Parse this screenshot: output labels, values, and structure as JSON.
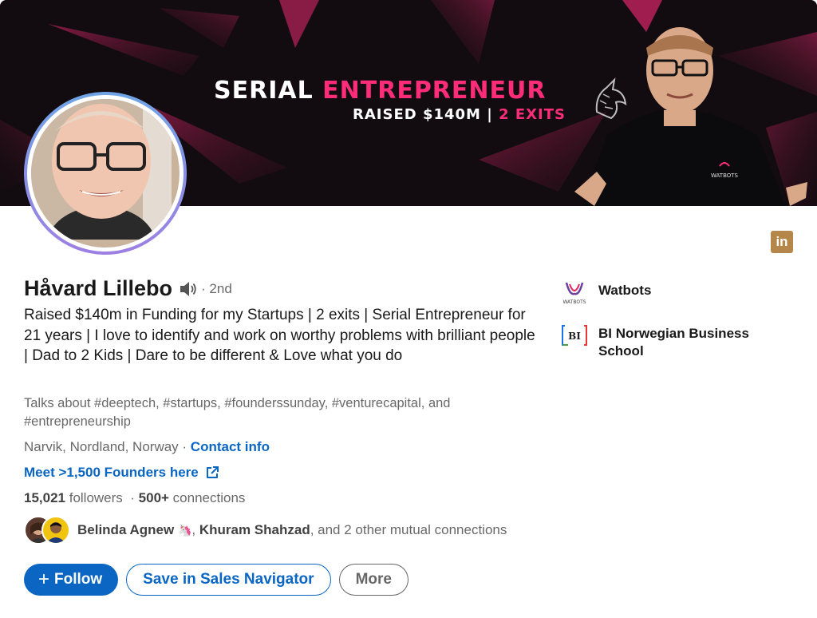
{
  "banner": {
    "title_white": "SERIAL",
    "title_accent": "ENTREPRENEUR",
    "subtitle_white": "RAISED $140M |",
    "subtitle_accent": "2 EXITS",
    "shirt_logo_text": "WATBOTS"
  },
  "profile": {
    "name": "Håvard Lillebo",
    "degree": "· 2nd",
    "headline": "Raised $140m in Funding for my Startups | 2 exits | Serial Entrepreneur for 21 years | I love to identify and work on worthy problems with brilliant people | Dad to 2 Kids | Dare to be different & Love what you do",
    "talks_about": "Talks about #deeptech, #startups, #founderssunday, #venturecapital, and #entrepreneurship",
    "location": "Narvik, Nordland, Norway",
    "location_sep": " · ",
    "contact_info": "Contact info",
    "website_link": "Meet >1,500 Founders here",
    "followers_count": "15,021",
    "followers_label": " followers",
    "connections_sep": "  · ",
    "connections_count": "500+",
    "connections_label": " connections"
  },
  "mutual": {
    "person1": "Belinda Agnew",
    "person1_emoji": "🦄",
    "sep": ", ",
    "person2": "Khuram Shahzad",
    "rest": ", and 2 other mutual connections"
  },
  "actions": {
    "follow": "Follow",
    "follow_prefix": "+",
    "sales_navigator": "Save in Sales Navigator",
    "more": "More"
  },
  "side": {
    "company": "Watbots",
    "company_logo_text": "WATBOTS",
    "school": "BI Norwegian Business School",
    "school_logo_text": "BI"
  },
  "linkedin_badge": "in",
  "colors": {
    "brand_blue": "#0a66c2",
    "banner_accent": "#ff2c7a",
    "banner_bg": "#120c10",
    "linkedin_badge": "#b5864a"
  },
  "icons": [
    "speaker-icon",
    "external-link-icon",
    "unicorn-icon",
    "plus-icon",
    "linkedin-icon"
  ]
}
